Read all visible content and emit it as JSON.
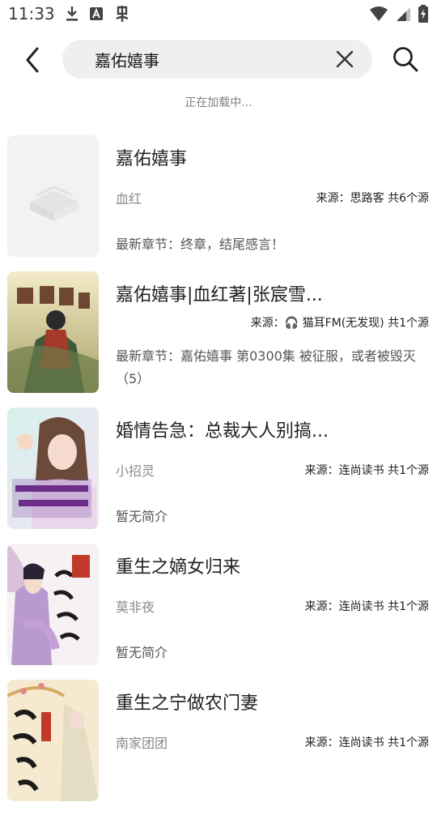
{
  "status_bar": {
    "time": "11:33",
    "icons_left": [
      "download-icon",
      "font-a-icon",
      "app-bug-icon"
    ],
    "icons_right": [
      "wifi-icon",
      "signal-icon",
      "battery-charging-icon"
    ]
  },
  "search": {
    "query": "嘉佑嬉事",
    "back_icon": "chevron-left-icon",
    "clear_icon": "close-icon",
    "search_icon": "search-icon"
  },
  "loading_text": "正在加载中...",
  "books": [
    {
      "title": "嘉佑嬉事",
      "author": "血红",
      "source": "来源：思路客 共6个源",
      "latest": "最新章节：终章，结尾感言！",
      "cover": "placeholder"
    },
    {
      "title": "嘉佑嬉事|血红著|张宸雪...",
      "author": "",
      "source": "来源：🎧 猫耳FM(无发现) 共1个源",
      "latest": "最新章节：嘉佑嬉事 第0300集 被征服，或者被毁灭（5）",
      "cover": "art"
    },
    {
      "title": "婚情告急：总裁大人别搞...",
      "author": "小招灵",
      "source": "来源：连尚读书 共1个源",
      "latest": "暂无简介",
      "cover": "art"
    },
    {
      "title": "重生之嫡女归来",
      "author": "莫非夜",
      "source": "来源：连尚读书 共1个源",
      "latest": "暂无简介",
      "cover": "art"
    },
    {
      "title": "重生之宁做农门妻",
      "author": "南家团团",
      "source": "来源：连尚读书 共1个源",
      "latest": "",
      "cover": "art"
    }
  ],
  "colors": {
    "search_bg": "#efefef",
    "title": "#222222",
    "muted": "#8a8a8a",
    "loading": "#808080"
  }
}
